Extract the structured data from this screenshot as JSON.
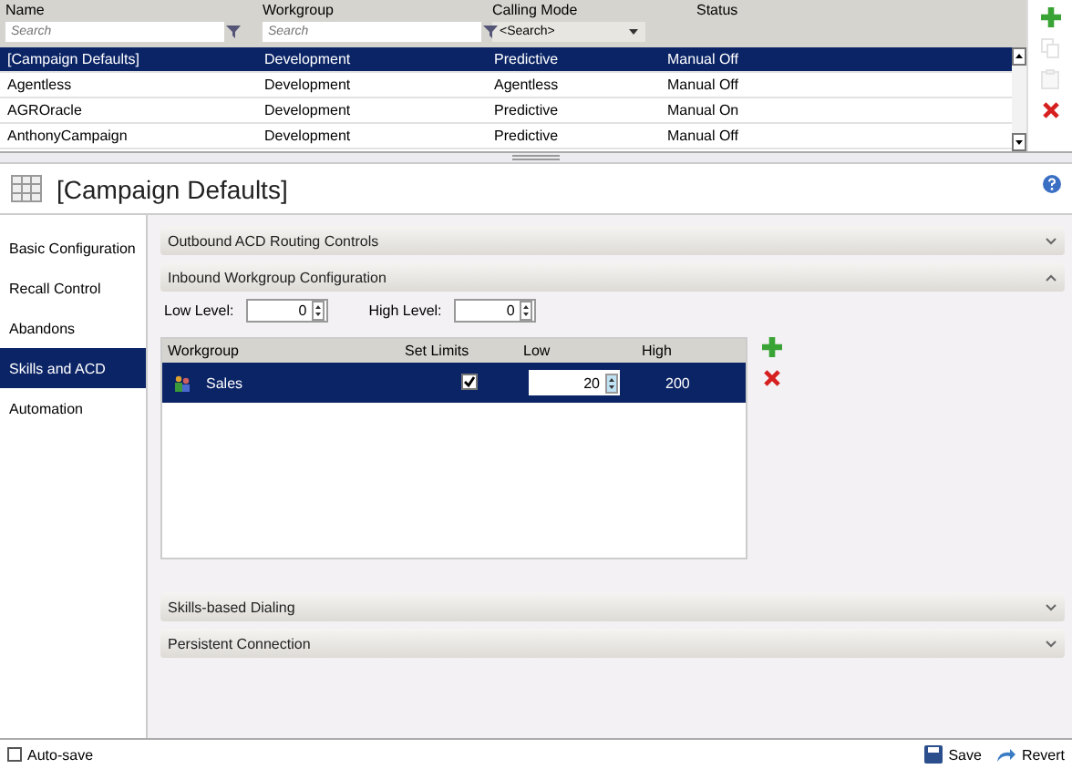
{
  "list": {
    "columns": [
      {
        "label": "Name",
        "filter": {
          "kind": "search",
          "placeholder": "Search"
        }
      },
      {
        "label": "Workgroup",
        "filter": {
          "kind": "search",
          "placeholder": "Search"
        }
      },
      {
        "label": "Calling Mode",
        "filter": {
          "kind": "dropdown",
          "value": "<Search>"
        }
      },
      {
        "label": "Status"
      }
    ],
    "rows": [
      {
        "cells": [
          "[Campaign Defaults]",
          "Development",
          "Predictive",
          "Manual Off"
        ],
        "selected": true
      },
      {
        "cells": [
          "Agentless",
          "Development",
          "Agentless",
          "Manual Off"
        ],
        "selected": false
      },
      {
        "cells": [
          "AGROracle",
          "Development",
          "Predictive",
          "Manual On"
        ],
        "selected": false
      },
      {
        "cells": [
          "AnthonyCampaign",
          "Development",
          "Predictive",
          "Manual Off"
        ],
        "selected": false
      }
    ],
    "tools": [
      {
        "kind": "add",
        "disabled": false
      },
      {
        "kind": "copy",
        "disabled": true
      },
      {
        "kind": "paste",
        "disabled": true
      },
      {
        "kind": "delete",
        "disabled": false
      }
    ]
  },
  "title": "[Campaign Defaults]",
  "nav": [
    {
      "label": "Basic Configuration",
      "selected": false
    },
    {
      "label": "Recall Control",
      "selected": false
    },
    {
      "label": "Abandons",
      "selected": false
    },
    {
      "label": "Skills and ACD",
      "selected": true
    },
    {
      "label": "Automation",
      "selected": false
    }
  ],
  "sections": [
    {
      "title": "Outbound ACD Routing Controls",
      "expanded": false
    },
    {
      "title": "Inbound Workgroup Configuration",
      "expanded": true,
      "low_level": {
        "label": "Low Level:",
        "value": "0"
      },
      "high_level": {
        "label": "High Level:",
        "value": "0"
      },
      "table": {
        "columns": [
          "Workgroup",
          "Set Limits",
          "Low",
          "High"
        ],
        "rows": [
          {
            "workgroup": "Sales",
            "set_limits": true,
            "low": "20",
            "high": "200",
            "selected": true
          }
        ]
      }
    },
    {
      "title": "Skills-based Dialing",
      "expanded": false
    },
    {
      "title": "Persistent Connection",
      "expanded": false
    }
  ],
  "footer": {
    "autosave": {
      "label": "Auto-save",
      "checked": false
    },
    "save": "Save",
    "revert": "Revert"
  }
}
